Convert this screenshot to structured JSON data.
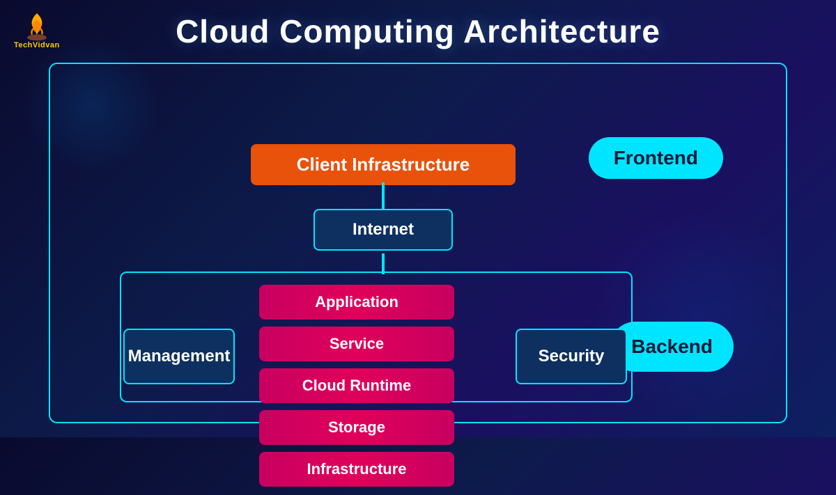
{
  "title": "Cloud Computing Architecture",
  "logo": {
    "name": "TechVidvan",
    "name_part1": "Tech",
    "name_part2": "Vidvan"
  },
  "diagram": {
    "client_infra": "Client Infrastructure",
    "internet": "Internet",
    "frontend": "Frontend",
    "backend": "Backend",
    "management": "Management",
    "security": "Security",
    "stack_items": [
      {
        "label": "Application"
      },
      {
        "label": "Service"
      },
      {
        "label": "Cloud Runtime"
      },
      {
        "label": "Storage"
      },
      {
        "label": "Infrastructure"
      }
    ]
  },
  "colors": {
    "accent_cyan": "#00e5ff",
    "accent_orange": "#e8520a",
    "accent_pink": "#c80060",
    "dark_blue": "#0d3060",
    "bg_dark": "#0a0a2e"
  }
}
